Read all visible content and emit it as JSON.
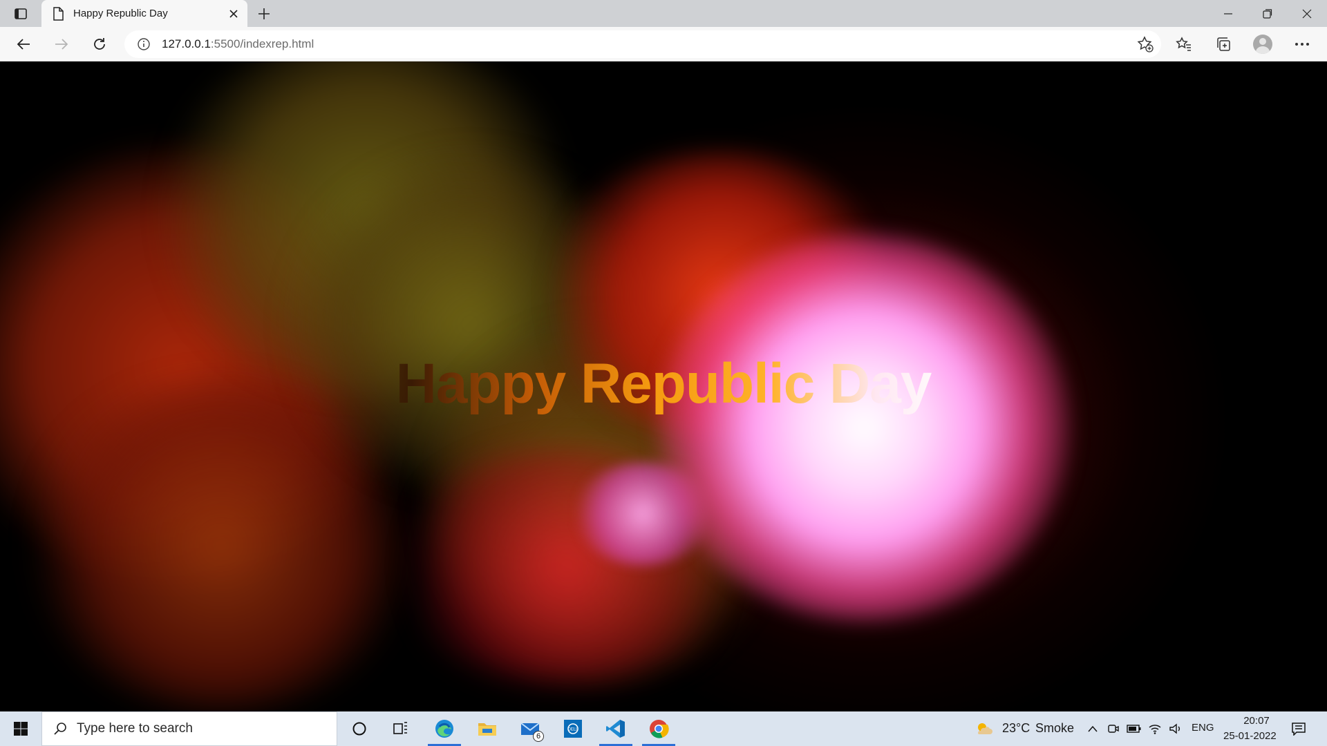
{
  "browser": {
    "tab": {
      "title": "Happy Republic Day"
    },
    "address": {
      "host": "127.0.0.1",
      "path": ":5500/indexrep.html"
    }
  },
  "page": {
    "headline": "Happy Republic Day",
    "colors": {
      "background": "#000000",
      "text_orange": "#f59a10",
      "glow_pink": "#ff9ef0",
      "smoke_red": "#b0220c",
      "smoke_olive": "#6b6a12"
    }
  },
  "taskbar": {
    "search_placeholder": "Type here to search",
    "apps": [
      {
        "name": "Task View",
        "icon": "task-view-icon"
      },
      {
        "name": "Microsoft Edge",
        "icon": "edge-icon",
        "active": true
      },
      {
        "name": "File Explorer",
        "icon": "folder-icon"
      },
      {
        "name": "Mail",
        "icon": "mail-icon",
        "badge": "6"
      },
      {
        "name": "Dell",
        "icon": "dell-icon"
      },
      {
        "name": "Visual Studio Code",
        "icon": "vscode-icon",
        "active": true
      },
      {
        "name": "Google Chrome",
        "icon": "chrome-icon",
        "active": true
      }
    ],
    "weather": {
      "temp": "23°C",
      "condition": "Smoke"
    },
    "language": "ENG",
    "time": "20:07",
    "date": "25-01-2022"
  }
}
